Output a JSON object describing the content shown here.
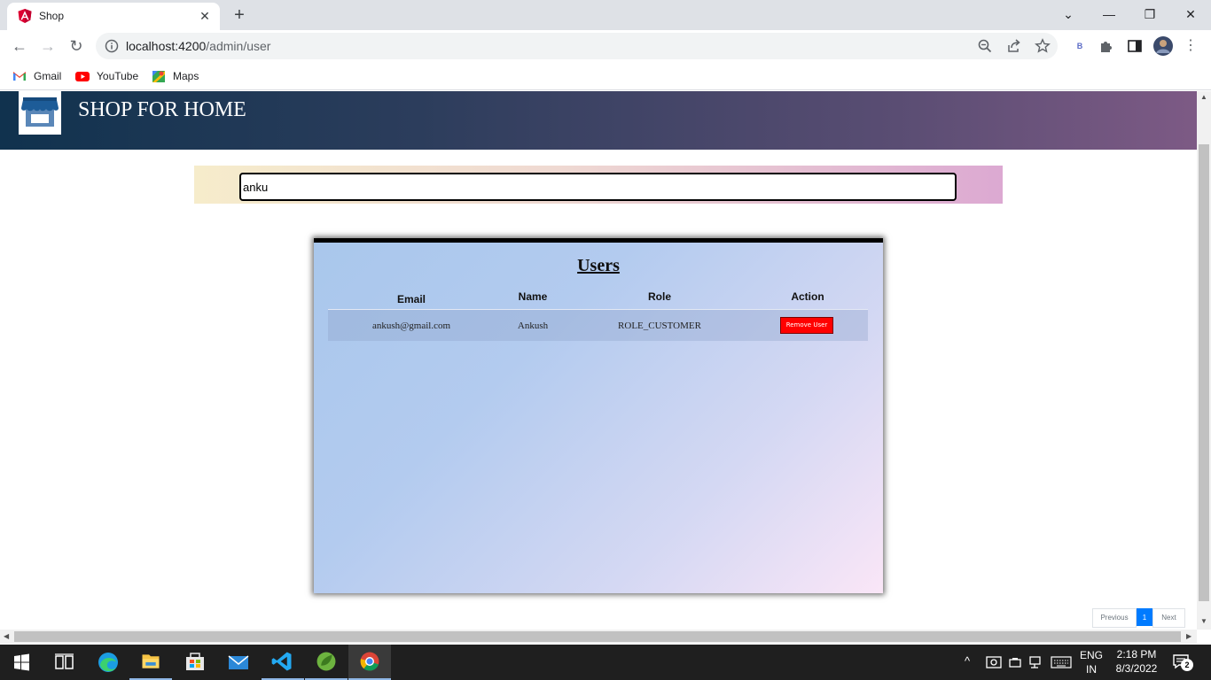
{
  "browser": {
    "tab_title": "Shop",
    "url_host": "localhost:4200",
    "url_path": "/admin/user",
    "profile_badge": "B",
    "bookmarks": [
      {
        "label": "Gmail"
      },
      {
        "label": "YouTube"
      },
      {
        "label": "Maps"
      }
    ]
  },
  "header": {
    "title": "SHOP FOR HOME"
  },
  "search": {
    "value": "anku"
  },
  "users_table": {
    "title": "Users",
    "columns": [
      "Email",
      "Name",
      "Role",
      "Action"
    ],
    "rows": [
      {
        "email": "ankush@gmail.com",
        "name": "Ankush",
        "role": "ROLE_CUSTOMER",
        "action": "Remove User"
      }
    ]
  },
  "pagination": {
    "previous": "Previous",
    "current_page": "1",
    "next": "Next"
  },
  "taskbar": {
    "lang_line1": "ENG",
    "lang_line2": "IN",
    "time": "2:18 PM",
    "date": "8/3/2022",
    "notification_count": "2"
  },
  "colors": {
    "header_start": "#10324e",
    "header_end": "#7d5a85",
    "remove_button": "#ff0000",
    "active_page": "#007bff"
  }
}
